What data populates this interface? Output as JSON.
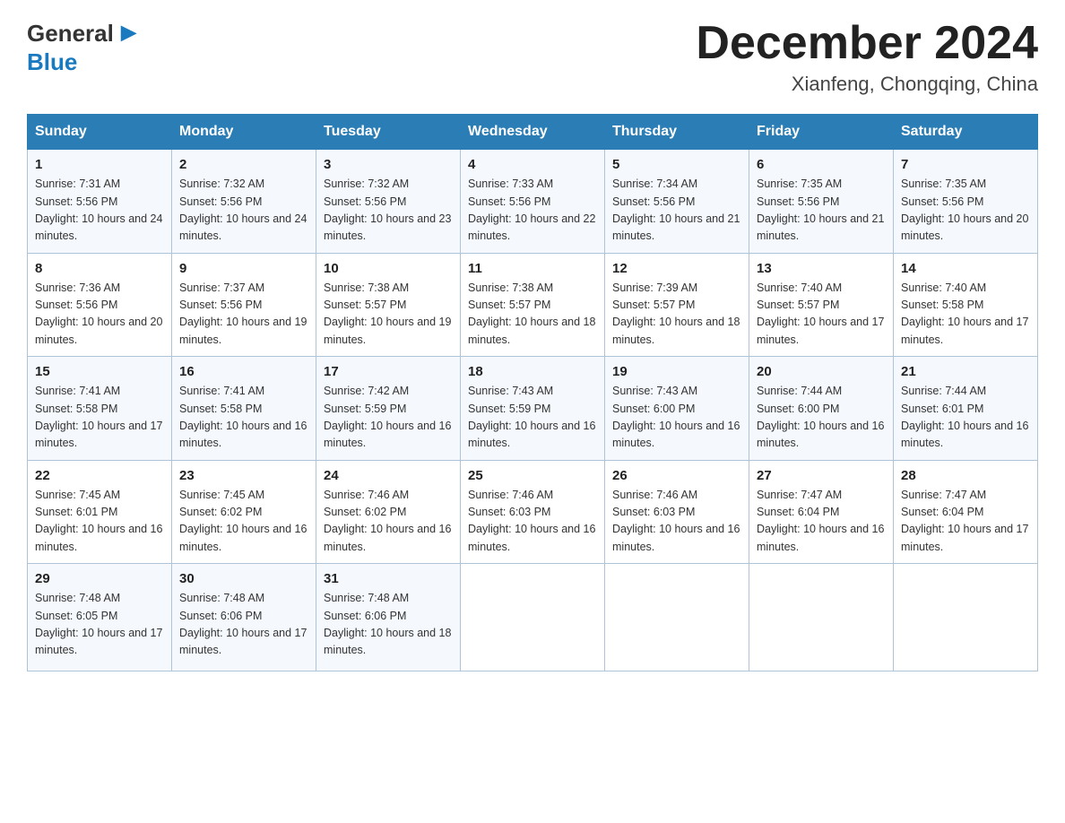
{
  "header": {
    "logo_general": "General",
    "logo_blue": "Blue",
    "month_title": "December 2024",
    "location": "Xianfeng, Chongqing, China"
  },
  "days_of_week": [
    "Sunday",
    "Monday",
    "Tuesday",
    "Wednesday",
    "Thursday",
    "Friday",
    "Saturday"
  ],
  "weeks": [
    [
      {
        "day": "1",
        "sunrise": "7:31 AM",
        "sunset": "5:56 PM",
        "daylight": "10 hours and 24 minutes."
      },
      {
        "day": "2",
        "sunrise": "7:32 AM",
        "sunset": "5:56 PM",
        "daylight": "10 hours and 24 minutes."
      },
      {
        "day": "3",
        "sunrise": "7:32 AM",
        "sunset": "5:56 PM",
        "daylight": "10 hours and 23 minutes."
      },
      {
        "day": "4",
        "sunrise": "7:33 AM",
        "sunset": "5:56 PM",
        "daylight": "10 hours and 22 minutes."
      },
      {
        "day": "5",
        "sunrise": "7:34 AM",
        "sunset": "5:56 PM",
        "daylight": "10 hours and 21 minutes."
      },
      {
        "day": "6",
        "sunrise": "7:35 AM",
        "sunset": "5:56 PM",
        "daylight": "10 hours and 21 minutes."
      },
      {
        "day": "7",
        "sunrise": "7:35 AM",
        "sunset": "5:56 PM",
        "daylight": "10 hours and 20 minutes."
      }
    ],
    [
      {
        "day": "8",
        "sunrise": "7:36 AM",
        "sunset": "5:56 PM",
        "daylight": "10 hours and 20 minutes."
      },
      {
        "day": "9",
        "sunrise": "7:37 AM",
        "sunset": "5:56 PM",
        "daylight": "10 hours and 19 minutes."
      },
      {
        "day": "10",
        "sunrise": "7:38 AM",
        "sunset": "5:57 PM",
        "daylight": "10 hours and 19 minutes."
      },
      {
        "day": "11",
        "sunrise": "7:38 AM",
        "sunset": "5:57 PM",
        "daylight": "10 hours and 18 minutes."
      },
      {
        "day": "12",
        "sunrise": "7:39 AM",
        "sunset": "5:57 PM",
        "daylight": "10 hours and 18 minutes."
      },
      {
        "day": "13",
        "sunrise": "7:40 AM",
        "sunset": "5:57 PM",
        "daylight": "10 hours and 17 minutes."
      },
      {
        "day": "14",
        "sunrise": "7:40 AM",
        "sunset": "5:58 PM",
        "daylight": "10 hours and 17 minutes."
      }
    ],
    [
      {
        "day": "15",
        "sunrise": "7:41 AM",
        "sunset": "5:58 PM",
        "daylight": "10 hours and 17 minutes."
      },
      {
        "day": "16",
        "sunrise": "7:41 AM",
        "sunset": "5:58 PM",
        "daylight": "10 hours and 16 minutes."
      },
      {
        "day": "17",
        "sunrise": "7:42 AM",
        "sunset": "5:59 PM",
        "daylight": "10 hours and 16 minutes."
      },
      {
        "day": "18",
        "sunrise": "7:43 AM",
        "sunset": "5:59 PM",
        "daylight": "10 hours and 16 minutes."
      },
      {
        "day": "19",
        "sunrise": "7:43 AM",
        "sunset": "6:00 PM",
        "daylight": "10 hours and 16 minutes."
      },
      {
        "day": "20",
        "sunrise": "7:44 AM",
        "sunset": "6:00 PM",
        "daylight": "10 hours and 16 minutes."
      },
      {
        "day": "21",
        "sunrise": "7:44 AM",
        "sunset": "6:01 PM",
        "daylight": "10 hours and 16 minutes."
      }
    ],
    [
      {
        "day": "22",
        "sunrise": "7:45 AM",
        "sunset": "6:01 PM",
        "daylight": "10 hours and 16 minutes."
      },
      {
        "day": "23",
        "sunrise": "7:45 AM",
        "sunset": "6:02 PM",
        "daylight": "10 hours and 16 minutes."
      },
      {
        "day": "24",
        "sunrise": "7:46 AM",
        "sunset": "6:02 PM",
        "daylight": "10 hours and 16 minutes."
      },
      {
        "day": "25",
        "sunrise": "7:46 AM",
        "sunset": "6:03 PM",
        "daylight": "10 hours and 16 minutes."
      },
      {
        "day": "26",
        "sunrise": "7:46 AM",
        "sunset": "6:03 PM",
        "daylight": "10 hours and 16 minutes."
      },
      {
        "day": "27",
        "sunrise": "7:47 AM",
        "sunset": "6:04 PM",
        "daylight": "10 hours and 16 minutes."
      },
      {
        "day": "28",
        "sunrise": "7:47 AM",
        "sunset": "6:04 PM",
        "daylight": "10 hours and 17 minutes."
      }
    ],
    [
      {
        "day": "29",
        "sunrise": "7:48 AM",
        "sunset": "6:05 PM",
        "daylight": "10 hours and 17 minutes."
      },
      {
        "day": "30",
        "sunrise": "7:48 AM",
        "sunset": "6:06 PM",
        "daylight": "10 hours and 17 minutes."
      },
      {
        "day": "31",
        "sunrise": "7:48 AM",
        "sunset": "6:06 PM",
        "daylight": "10 hours and 18 minutes."
      },
      null,
      null,
      null,
      null
    ]
  ],
  "labels": {
    "sunrise_prefix": "Sunrise: ",
    "sunset_prefix": "Sunset: ",
    "daylight_prefix": "Daylight: "
  }
}
